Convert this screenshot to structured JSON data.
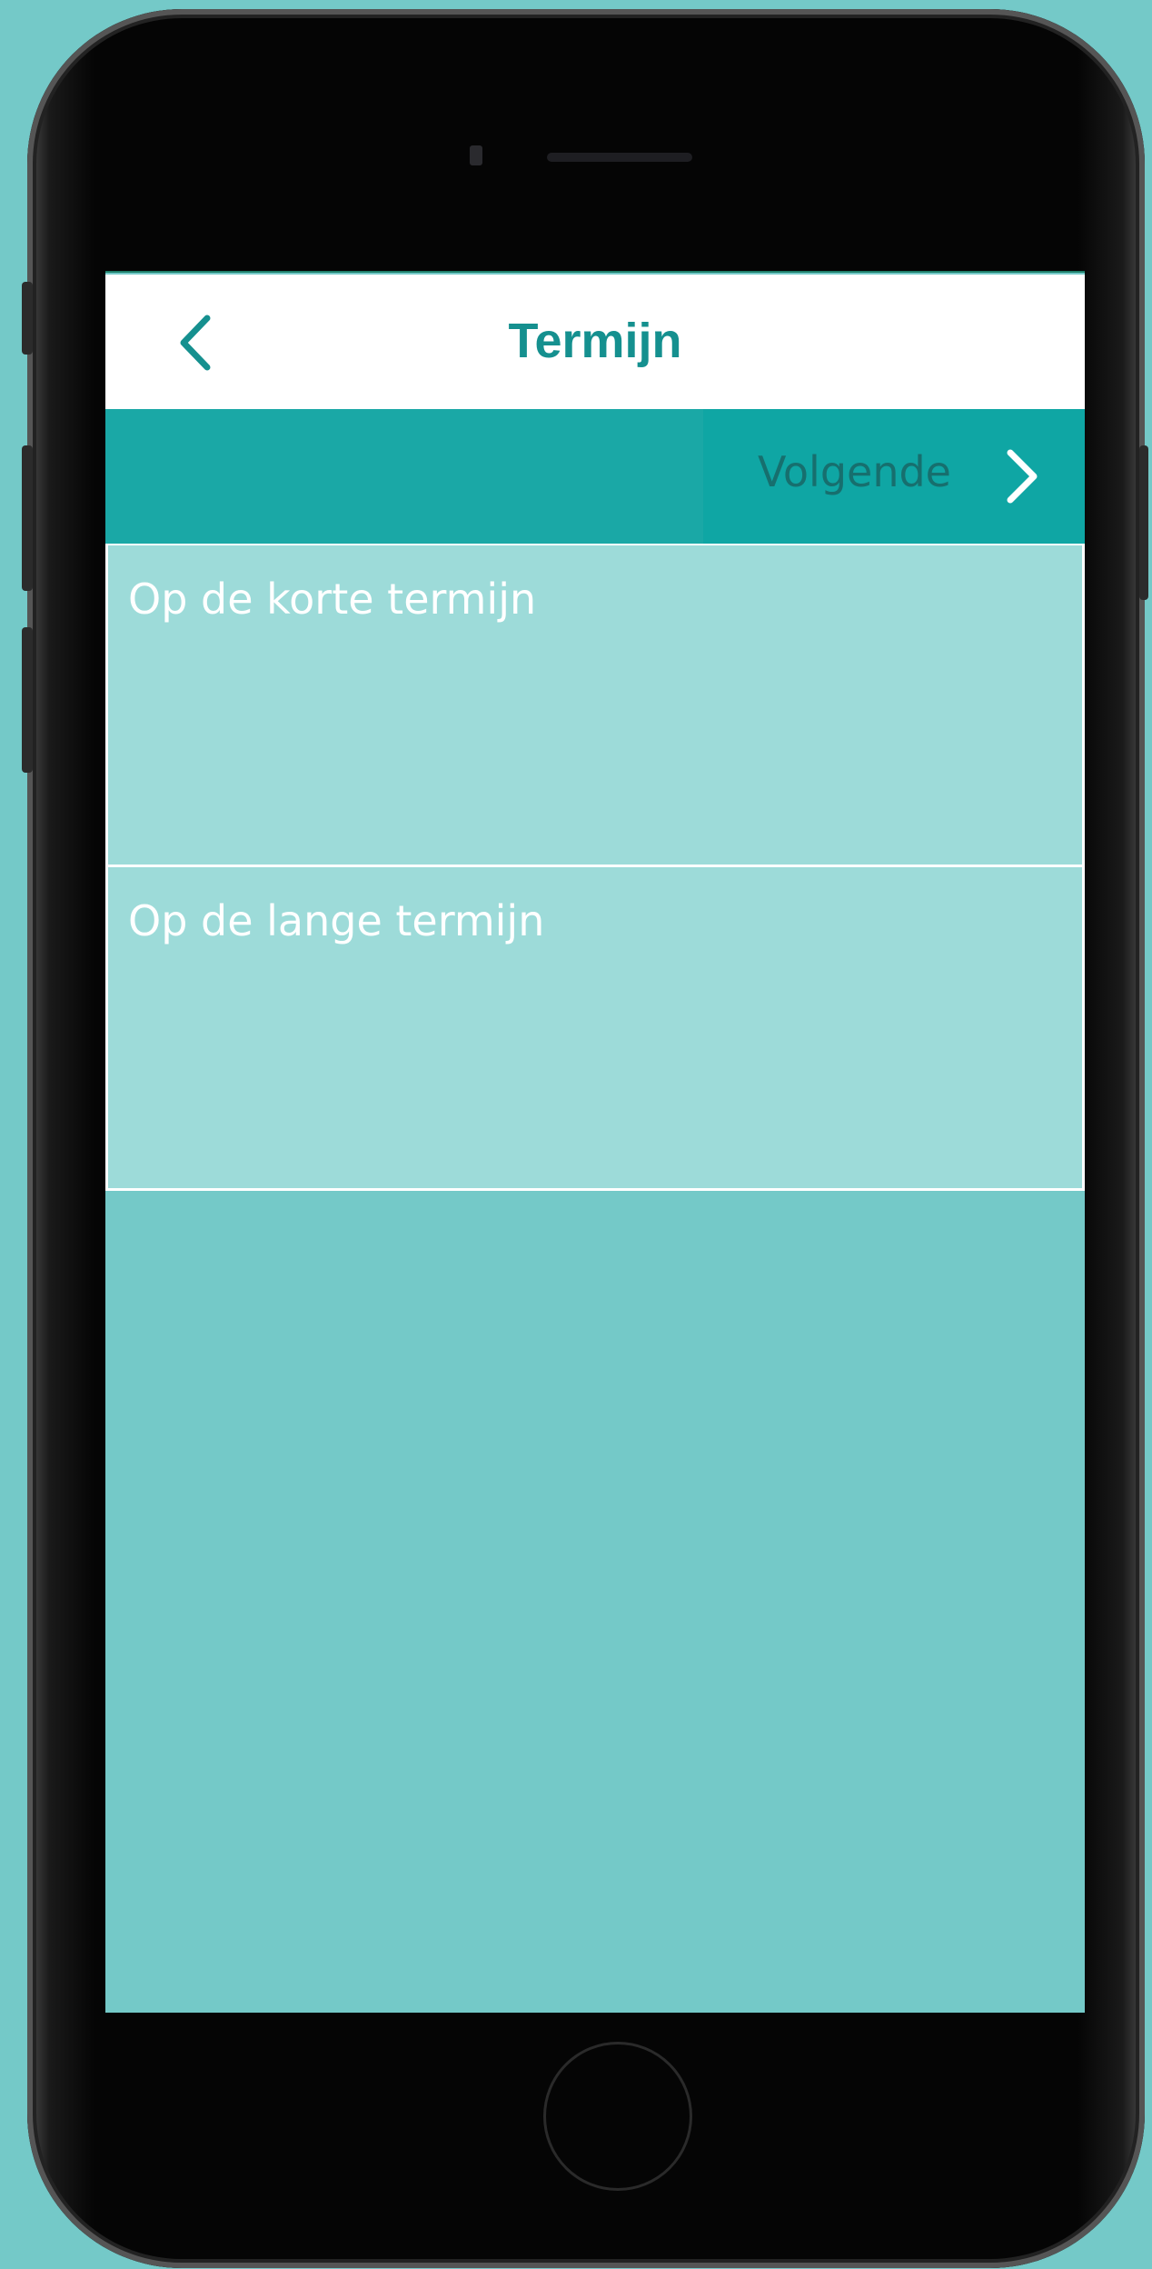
{
  "header": {
    "title": "Termijn",
    "back_icon": "chevron-left-icon"
  },
  "navigation": {
    "next_label": "Volgende",
    "next_icon": "chevron-right-icon"
  },
  "options": [
    {
      "label": "Op de korte termijn"
    },
    {
      "label": "Op de lange termijn"
    }
  ],
  "colors": {
    "background": "#74c9c8",
    "accent": "#15908f",
    "navbar": "#1aa8a6",
    "list_item": "#9ddbd9"
  }
}
